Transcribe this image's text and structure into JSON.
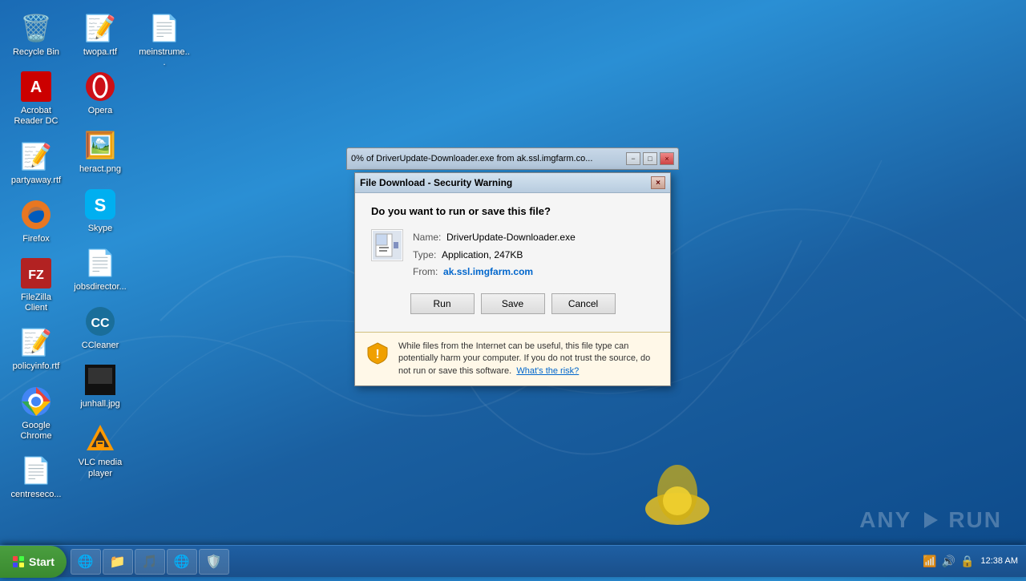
{
  "desktop": {
    "icons": [
      {
        "id": "recycle-bin",
        "label": "Recycle Bin",
        "icon": "🗑️",
        "col": 0,
        "row": 0
      },
      {
        "id": "acrobat",
        "label": "Acrobat Reader DC",
        "icon": "📄",
        "col": 0,
        "row": 1
      },
      {
        "id": "partyaway",
        "label": "partyaway.rtf",
        "icon": "📝",
        "col": 0,
        "row": 2
      },
      {
        "id": "firefox",
        "label": "Firefox",
        "icon": "🦊",
        "col": 1,
        "row": 0
      },
      {
        "id": "filezilla",
        "label": "FileZilla Client",
        "icon": "📁",
        "col": 1,
        "row": 1
      },
      {
        "id": "policyinfo",
        "label": "policyinfo.rtf",
        "icon": "📝",
        "col": 1,
        "row": 2
      },
      {
        "id": "chrome",
        "label": "Google Chrome",
        "icon": "🌐",
        "col": 2,
        "row": 0
      },
      {
        "id": "centreseco",
        "label": "centreseco...",
        "icon": "📄",
        "col": 2,
        "row": 1
      },
      {
        "id": "twopa",
        "label": "twopa.rtf",
        "icon": "📝",
        "col": 2,
        "row": 2
      },
      {
        "id": "opera",
        "label": "Opera",
        "icon": "⭕",
        "col": 3,
        "row": 0
      },
      {
        "id": "heract",
        "label": "heract.png",
        "icon": "🖼️",
        "col": 3,
        "row": 1
      },
      {
        "id": "skype",
        "label": "Skype",
        "icon": "💬",
        "col": 4,
        "row": 0
      },
      {
        "id": "jobsdirector",
        "label": "jobsdirector...",
        "icon": "📄",
        "col": 4,
        "row": 1
      },
      {
        "id": "ccleaner",
        "label": "CCleaner",
        "icon": "🧹",
        "col": 5,
        "row": 0
      },
      {
        "id": "junhall",
        "label": "junhall.jpg",
        "icon": "🖼️",
        "col": 5,
        "row": 1
      },
      {
        "id": "vlc",
        "label": "VLC media player",
        "icon": "🎬",
        "col": 6,
        "row": 0
      },
      {
        "id": "meinstrume",
        "label": "meinstrume...",
        "icon": "📄",
        "col": 6,
        "row": 1
      }
    ]
  },
  "download_progress": {
    "title": "0% of DriverUpdate-Downloader.exe from ak.ssl.imgfarm.co...",
    "min_btn": "−",
    "max_btn": "□",
    "close_btn": "×"
  },
  "security_dialog": {
    "title": "File Download - Security Warning",
    "close_btn": "×",
    "question": "Do you want to run or save this file?",
    "file_name_label": "Name:",
    "file_name_value": "DriverUpdate-Downloader.exe",
    "file_type_label": "Type:",
    "file_type_value": "Application, 247KB",
    "file_from_label": "From:",
    "file_from_value": "ak.ssl.imgfarm.com",
    "run_btn": "Run",
    "save_btn": "Save",
    "cancel_btn": "Cancel",
    "warning_text": "While files from the Internet can be useful, this file type can potentially harm your computer. If you do not trust the source, do not run or save this software.",
    "whats_risk_link": "What's the risk?"
  },
  "taskbar": {
    "start_label": "Start",
    "items": [
      {
        "id": "ie",
        "icon": "🌐"
      },
      {
        "id": "explorer",
        "icon": "📁"
      },
      {
        "id": "media",
        "icon": "🎵"
      },
      {
        "id": "chrome-tb",
        "icon": "🌐"
      },
      {
        "id": "security",
        "icon": "🛡️"
      }
    ],
    "clock": "12:38 AM",
    "tray_icons": [
      "🔊",
      "📶",
      "🔒"
    ]
  }
}
